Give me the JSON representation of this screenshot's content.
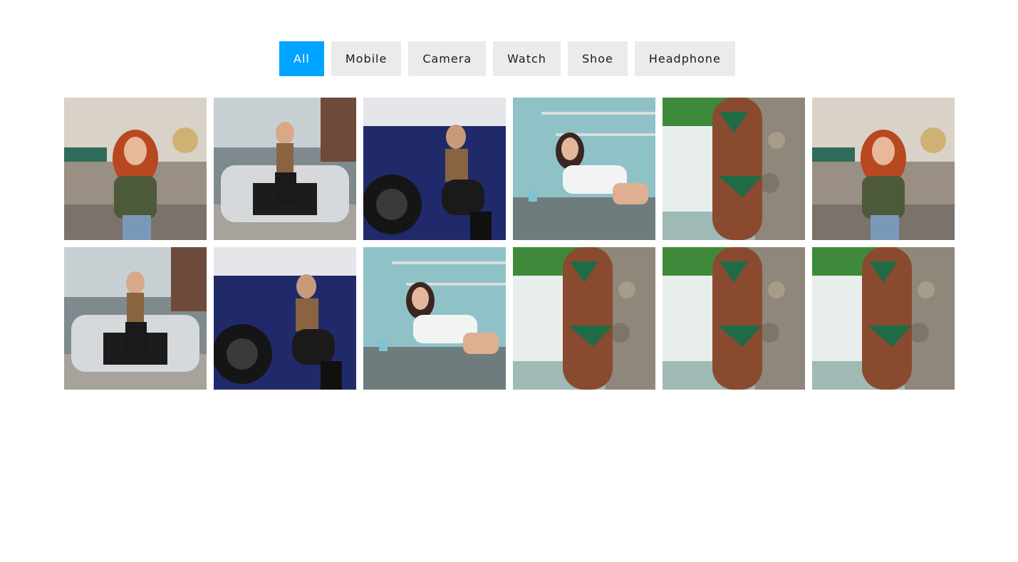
{
  "filters": [
    {
      "label": "All",
      "active": true
    },
    {
      "label": "Mobile",
      "active": false
    },
    {
      "label": "Camera",
      "active": false
    },
    {
      "label": "Watch",
      "active": false
    },
    {
      "label": "Shoe",
      "active": false
    },
    {
      "label": "Headphone",
      "active": false
    }
  ],
  "colors": {
    "active_bg": "#00a3ff",
    "inactive_bg": "#ebebeb"
  },
  "gallery": [
    {
      "photo": "redhead-fairground"
    },
    {
      "photo": "silver-car-woman"
    },
    {
      "photo": "blue-car-woman"
    },
    {
      "photo": "kitchen-woman"
    },
    {
      "photo": "bikini-stone-wall"
    },
    {
      "photo": "redhead-fairground"
    },
    {
      "photo": "silver-car-woman"
    },
    {
      "photo": "blue-car-woman"
    },
    {
      "photo": "kitchen-woman"
    },
    {
      "photo": "bikini-stone-wall"
    },
    {
      "photo": "bikini-stone-wall"
    },
    {
      "photo": "bikini-stone-wall"
    }
  ]
}
